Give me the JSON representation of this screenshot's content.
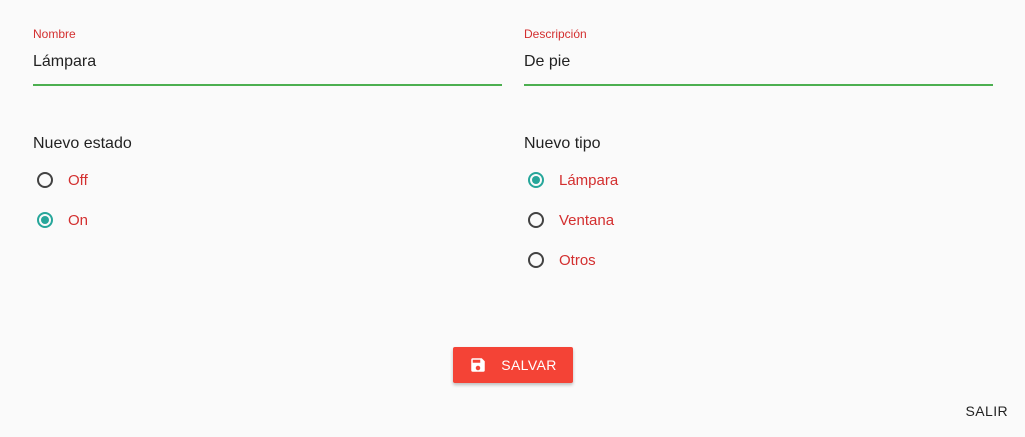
{
  "form": {
    "nombre": {
      "label": "Nombre",
      "value": "Lámpara"
    },
    "descripcion": {
      "label": "Descripción",
      "value": "De pie"
    }
  },
  "estado": {
    "title": "Nuevo estado",
    "options": [
      {
        "label": "Off",
        "checked": false
      },
      {
        "label": "On",
        "checked": true
      }
    ]
  },
  "tipo": {
    "title": "Nuevo tipo",
    "options": [
      {
        "label": "Lámpara",
        "checked": true
      },
      {
        "label": "Ventana",
        "checked": false
      },
      {
        "label": "Otros",
        "checked": false
      }
    ]
  },
  "actions": {
    "save_label": "SALVAR",
    "save_icon": "save-icon",
    "exit_label": "SALIR"
  },
  "colors": {
    "accent": "#26a69a",
    "label_red": "#d32f2f",
    "underline_green": "#4caf50",
    "save_button": "#f44336"
  }
}
